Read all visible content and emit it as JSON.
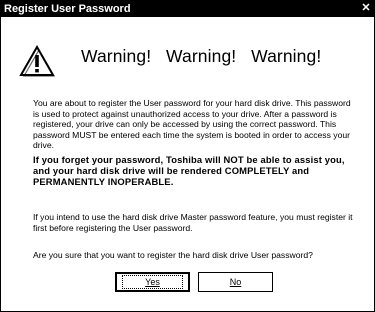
{
  "window": {
    "title": "Register User Password",
    "close_symbol": "✕"
  },
  "warning": {
    "icon": "exclamation-triangle-icon",
    "headline": "Warning!   Warning!   Warning!"
  },
  "paragraphs": {
    "p1": "You are about to register the User password for your hard disk drive. This password is used to protect against unauthorized access to your drive.  After a password is registered, your drive can only be accessed by using the correct password.  This password MUST be entered each time the system is booted in order to access your drive.",
    "p2": "If you forget your password, Toshiba will NOT be able to assist you, and your hard disk drive will be rendered COMPLETELY and PERMANENTLY INOPERABLE.",
    "p3": "If you intend to use the hard disk drive Master password feature, you must register it first before registering the User password.",
    "p4": "Are you sure that you want to register the hard disk drive User password?"
  },
  "buttons": {
    "yes_label": "Yes",
    "no_label": "No"
  }
}
